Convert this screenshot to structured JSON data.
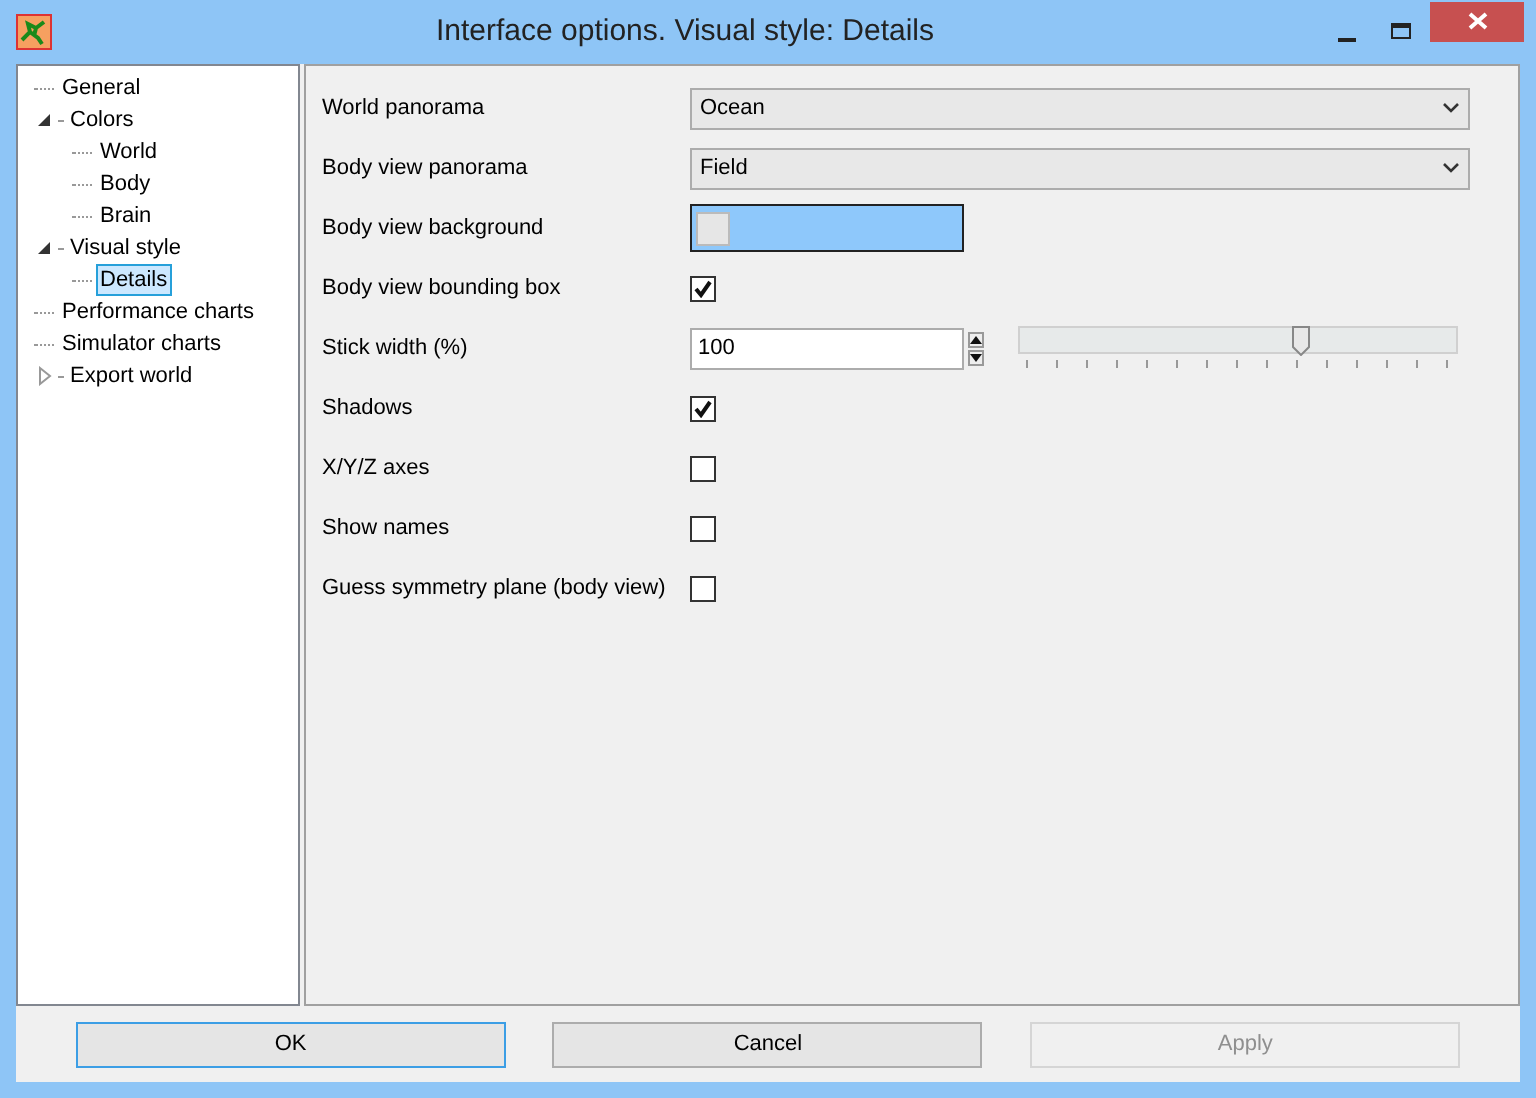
{
  "window": {
    "title": "Interface options. Visual style: Details"
  },
  "tree": [
    {
      "label": "General",
      "selected": false
    },
    {
      "label": "Colors",
      "selected": false,
      "expanded": true,
      "children": [
        {
          "label": "World",
          "selected": false
        },
        {
          "label": "Body",
          "selected": false
        },
        {
          "label": "Brain",
          "selected": false
        }
      ]
    },
    {
      "label": "Visual style",
      "selected": false,
      "expanded": true,
      "children": [
        {
          "label": "Details",
          "selected": true
        }
      ]
    },
    {
      "label": "Performance charts",
      "selected": false
    },
    {
      "label": "Simulator charts",
      "selected": false
    },
    {
      "label": "Export world",
      "selected": false,
      "expanded": false
    }
  ],
  "settings": [
    {
      "kind": "combo",
      "label": "World panorama",
      "value": "Ocean"
    },
    {
      "kind": "combo",
      "label": "Body view panorama",
      "value": "Field"
    },
    {
      "kind": "color",
      "label": "Body view background",
      "color": "#8ec8fb"
    },
    {
      "kind": "checkbox",
      "label": "Body view bounding box",
      "checked": true
    },
    {
      "kind": "spin",
      "label": "Stick width (%)",
      "value": "100",
      "level": 0.64
    },
    {
      "kind": "checkbox",
      "label": "Shadows",
      "checked": true
    },
    {
      "kind": "checkbox",
      "label": "X/Y/Z axes",
      "checked": false
    },
    {
      "kind": "checkbox",
      "label": "Show names",
      "checked": false
    },
    {
      "kind": "checkbox",
      "label": "Guess symmetry plane (body view)",
      "checked": false
    }
  ],
  "buttons": [
    {
      "label": "OK",
      "disabled": false,
      "focused": true
    },
    {
      "label": "Cancel",
      "disabled": false,
      "focused": false
    },
    {
      "label": "Apply",
      "disabled": true,
      "focused": false
    }
  ]
}
